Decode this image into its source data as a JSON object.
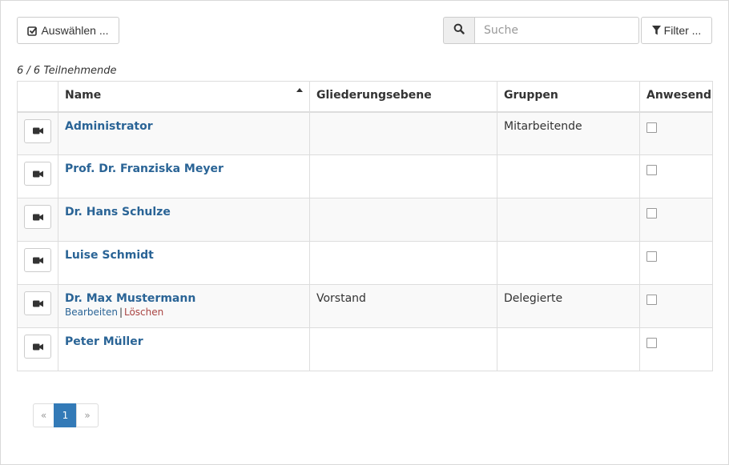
{
  "toolbar": {
    "select_label": "Auswählen ...",
    "filter_label": "Filter ...",
    "search_placeholder": "Suche"
  },
  "count_text": "6 / 6 Teilnehmende",
  "table": {
    "columns": [
      "Name",
      "Gliederungsebene",
      "Gruppen",
      "Anwesend"
    ],
    "rows": [
      {
        "name": "Administrator",
        "level": "",
        "groups": "Mitarbeitende",
        "present": false
      },
      {
        "name": "Prof. Dr. Franziska Meyer",
        "level": "",
        "groups": "",
        "present": false
      },
      {
        "name": "Dr. Hans Schulze",
        "level": "",
        "groups": "",
        "present": false
      },
      {
        "name": "Luise Schmidt",
        "level": "",
        "groups": "",
        "present": false
      },
      {
        "name": "Dr. Max Mustermann",
        "level": "Vorstand",
        "groups": "Delegierte",
        "present": false,
        "actions": {
          "edit": "Bearbeiten",
          "separator": "|",
          "delete": "Löschen"
        }
      },
      {
        "name": "Peter Müller",
        "level": "",
        "groups": "",
        "present": false
      }
    ]
  },
  "pagination": {
    "prev": "«",
    "current": "1",
    "next": "»"
  },
  "icons": {
    "select": "check-square-icon",
    "search": "search-icon",
    "filter": "filter-icon",
    "camera": "video-camera-icon",
    "sort": "sort-ascending-icon"
  },
  "colors": {
    "link": "#2a6496",
    "delete": "#a94442",
    "page_active": "#337ab7"
  }
}
